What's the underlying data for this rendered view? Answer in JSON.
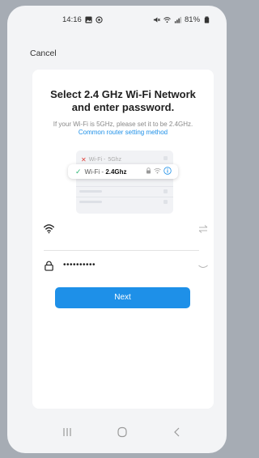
{
  "status_bar": {
    "time": "14:16",
    "left_icons": [
      "image-icon",
      "settings-icon"
    ],
    "right_icons": [
      "mute-icon",
      "wifi-signal-icon",
      "cell-signal-icon"
    ],
    "battery": "81%",
    "battery_icon": "battery-icon"
  },
  "topbar": {
    "cancel_label": "Cancel"
  },
  "content": {
    "title": "Select 2.4 GHz Wi-Fi Network and enter password.",
    "hint": "If your Wi-Fi is 5GHz, please set it to be 2.4GHz.",
    "hint_link": "Common router setting method",
    "illustration": {
      "row_5g_prefix": "Wi-Fi - ",
      "row_5g_band": "5Ghz",
      "row_24_prefix": "Wi-Fi - ",
      "row_24_band": "2.4Ghz"
    },
    "wifi_field": {
      "value": "",
      "icon": "wifi-icon",
      "action_icon": "swap-icon"
    },
    "password_field": {
      "value": "••••••••••",
      "icon": "lock-icon",
      "action_icon": "eye-closed-icon"
    },
    "next_label": "Next"
  },
  "navbar": {
    "buttons": [
      "recent-apps-icon",
      "home-icon",
      "back-icon"
    ]
  },
  "colors": {
    "accent": "#1e90e8",
    "success": "#2bb673",
    "error": "#e0403a",
    "background": "#f3f4f6"
  }
}
